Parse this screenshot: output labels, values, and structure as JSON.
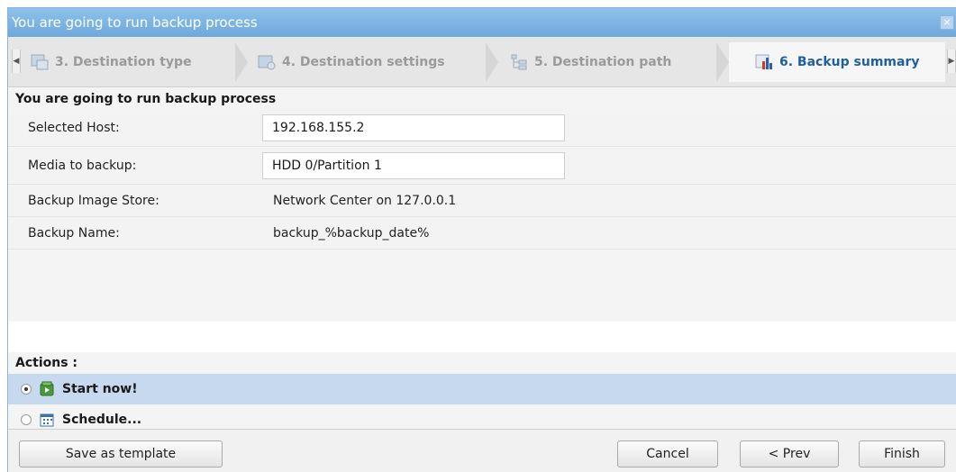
{
  "window": {
    "title": "You are going to run backup process",
    "close_glyph": "×"
  },
  "steps": [
    {
      "label": "3. Destination type",
      "icon": "destination-type-icon"
    },
    {
      "label": "4. Destination settings",
      "icon": "destination-settings-icon"
    },
    {
      "label": "5. Destination path",
      "icon": "destination-path-icon"
    },
    {
      "label": "6. Backup summary",
      "icon": "backup-summary-icon",
      "active": true
    }
  ],
  "nav": {
    "left_arrow": "◀",
    "right_arrow": "▶"
  },
  "summary": {
    "title": "You are going to run backup process",
    "selected_host_label": "Selected Host:",
    "selected_host_value": "192.168.155.2",
    "media_label": "Media to backup:",
    "media_value": "HDD 0/Partition 1",
    "store_label": "Backup Image Store:",
    "store_value": "Network Center on 127.0.0.1",
    "name_label": "Backup Name:",
    "name_value": "backup_%backup_date%"
  },
  "actions": {
    "title": "Actions :",
    "start_now": "Start now!",
    "schedule": "Schedule...",
    "selected": "start_now"
  },
  "footer": {
    "save_template": "Save as template",
    "cancel": "Cancel",
    "prev": "< Prev",
    "finish": "Finish"
  },
  "colors": {
    "accent": "#1f5f9f",
    "titlebar": "#7db5e3",
    "selected_row": "#c7d9ee"
  }
}
